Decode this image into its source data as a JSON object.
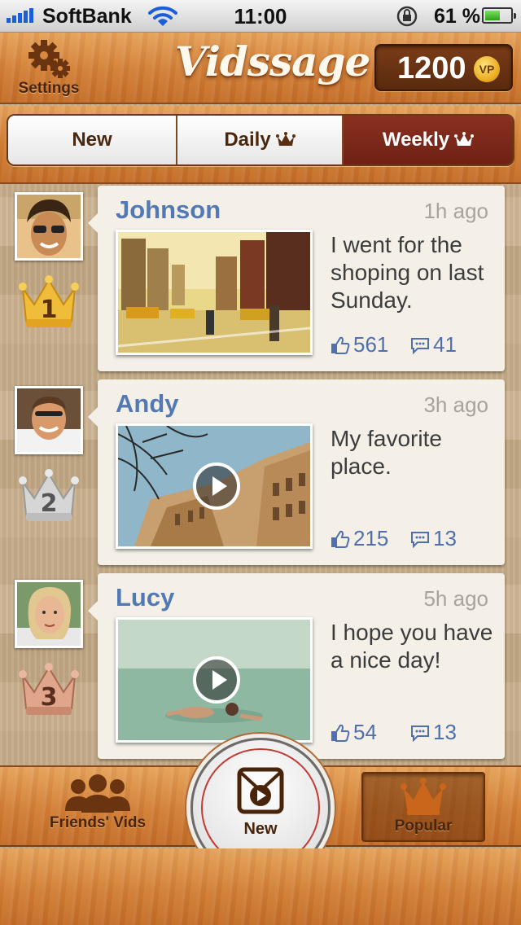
{
  "status_bar": {
    "carrier": "SoftBank",
    "time": "11:00",
    "battery_percent": "61 %",
    "battery_level": 0.61,
    "icons": [
      "signal-icon",
      "wifi-icon",
      "rotation-lock-icon",
      "battery-icon"
    ]
  },
  "header": {
    "settings_label": "Settings",
    "logo_text": "Vidssage",
    "points": "1200",
    "points_unit": "VP"
  },
  "tabs": {
    "new_label": "New",
    "daily_label": "Daily",
    "weekly_label": "Weekly",
    "selected": "Weekly"
  },
  "feed": [
    {
      "rank": "1",
      "author": "Johnson",
      "time": "1h ago",
      "message": "I went for the shoping on last Sunday.",
      "likes": "561",
      "comments": "41",
      "has_video": false
    },
    {
      "rank": "2",
      "author": "Andy",
      "time": "3h ago",
      "message": "My favorite place.",
      "likes": "215",
      "comments": "13",
      "has_video": true
    },
    {
      "rank": "3",
      "author": "Lucy",
      "time": "5h ago",
      "message": "I hope you have a nice day!",
      "likes": "54",
      "comments": "13",
      "has_video": true
    }
  ],
  "tabbar": {
    "friends_label": "Friends' Vids",
    "new_label": "New",
    "popular_label": "Popular",
    "selected": "Popular"
  },
  "colors": {
    "accent_red": "#6e2114",
    "name_blue": "#5279b5",
    "gold": "#e8a817",
    "silver": "#b9b9b9",
    "bronze": "#c98a70"
  }
}
